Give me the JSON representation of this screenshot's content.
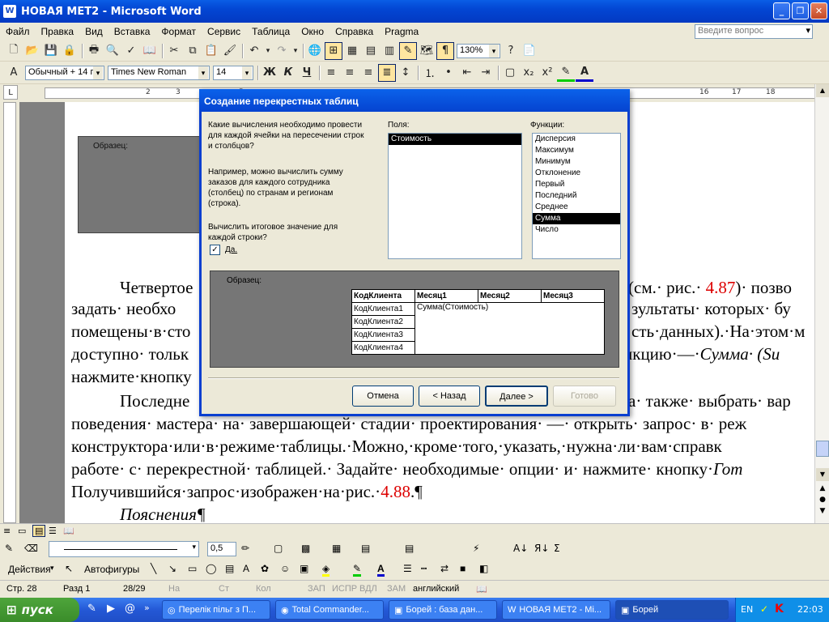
{
  "window": {
    "title": "НОВАЯ МЕТ2 - Microsoft Word"
  },
  "menu": {
    "items": [
      "Файл",
      "Правка",
      "Вид",
      "Вставка",
      "Формат",
      "Сервис",
      "Таблица",
      "Окно",
      "Справка",
      "Pragma"
    ],
    "ask_placeholder": "Введите вопрос"
  },
  "toolbar": {
    "zoom": "130%"
  },
  "format": {
    "style": "Обычный + 14 г",
    "font": "Times New Roman",
    "size": "14"
  },
  "doc": {
    "line1a": "Четвертое",
    "line1b": "(см.· рис.·",
    "line1c": "4.87",
    "line1d": ")· позво",
    "line2a": "задать· необхо",
    "line2b": "зультаты· которых· бу",
    "line3a": "помещены·в·сто",
    "line3b": "сть·данных).·На·этом·м",
    "line4a": "доступно· тольк",
    "line4b": "нкцию·",
    "line4c": "—·",
    "line4d": "Сумма· (Su",
    "line5a": "нажмите·кнопку",
    "line6a": "Последне",
    "line6b": "а· также· выбрать· вар",
    "line7": "поведения· мастера· на· завершающей· стадии· проектирования· —· открыть· запрос· в· реж",
    "line8": "конструктора·или·в·режиме·таблицы.·Можно,·кроме·того,·указать,·нужна·ли·вам·справк",
    "line9a": "работе· с· перекрестной· таблицей.· Задайте· необходимые· опции· и· нажмите· кнопку·",
    "line9b": "Гот",
    "line10a": "Получившийся·запрос·изображен·на·рис.·",
    "line10b": "4.88",
    "line10c": ".¶",
    "line11": "Пояснения¶",
    "bg_sample_label": "Образец:"
  },
  "dialog": {
    "title": "Создание перекрестных таблиц",
    "question": "Какие вычисления необходимо провести для каждой ячейки на пересечении строк и столбцов?",
    "example": "Например, можно вычислить сумму заказов для каждого сотрудника (столбец) по странам и регионам (строка).",
    "total_q": "Вычислить итоговое значение для каждой строки?",
    "checkbox_label": "Да.",
    "fields_label": "Поля:",
    "fields": [
      "Стоимость"
    ],
    "functions_label": "Функции:",
    "functions": [
      "Дисперсия",
      "Максимум",
      "Минимум",
      "Отклонение",
      "Первый",
      "Последний",
      "Среднее",
      "Сумма",
      "Число"
    ],
    "selected_function": "Сумма",
    "sample_label": "Образец:",
    "grid_headers": [
      "КодКлиента",
      "Месяц1",
      "Месяц2",
      "Месяц3"
    ],
    "grid_rows": [
      "КодКлиента1",
      "КодКлиента2",
      "КодКлиента3",
      "КодКлиента4"
    ],
    "grid_value": "Сумма(Стоимость)",
    "buttons": {
      "cancel": "Отмена",
      "back": "< Назад",
      "next": "Далее >",
      "finish": "Готово"
    }
  },
  "drawing": {
    "actions": "Действия",
    "autoshapes": "Автофигуры",
    "line_width": "0,5"
  },
  "status": {
    "page": "Стр. 28",
    "section": "Разд 1",
    "pages": "28/29",
    "at": "На",
    "ln": "Ст",
    "col": "Кол",
    "rec": "ЗАП",
    "trk": "ИСПР",
    "ext": "ВДЛ",
    "ovr": "ЗАМ",
    "lang": "английский"
  },
  "taskbar": {
    "start": "пуск",
    "tasks": [
      "Перелік пільг з П...",
      "Total Commander...",
      "Борей : база дан...",
      "НОВАЯ МЕТ2 - Mi...",
      "Борей"
    ],
    "lang": "EN",
    "clock": "22:03"
  }
}
